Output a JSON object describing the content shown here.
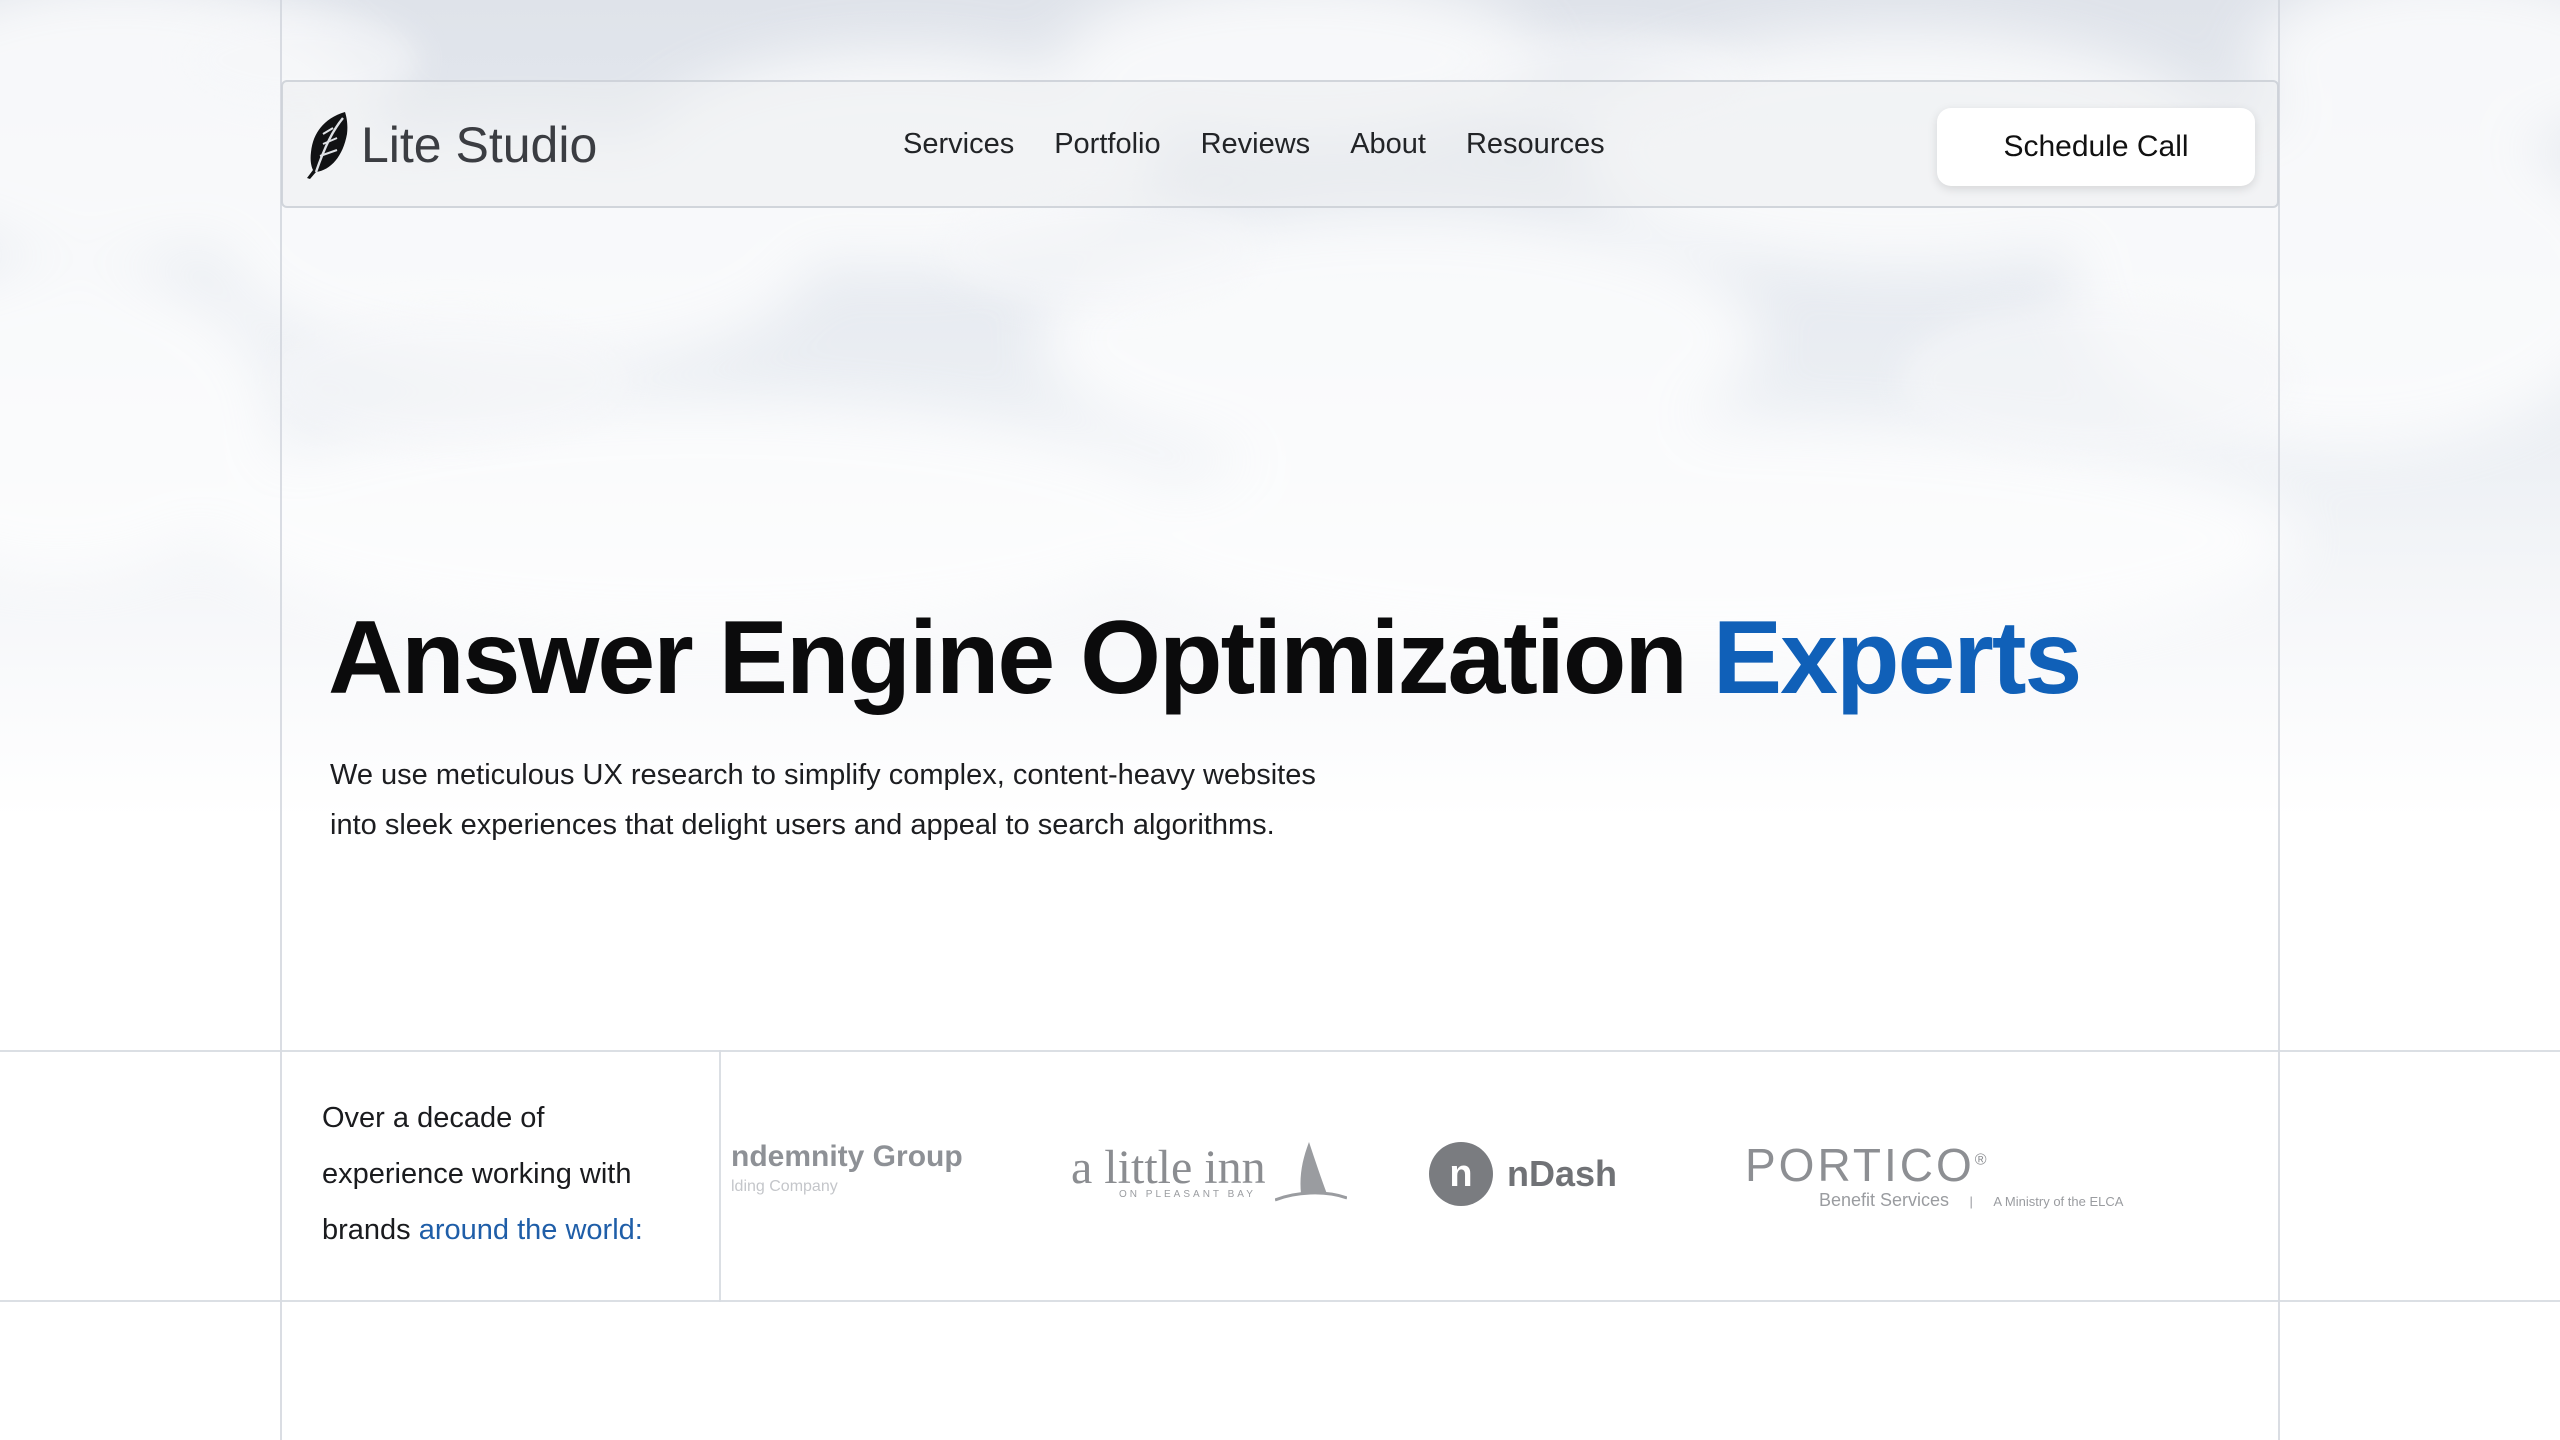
{
  "brand": {
    "name": "Lite Studio",
    "logo_icon": "feather-icon"
  },
  "nav": {
    "items": [
      {
        "label": "Services"
      },
      {
        "label": "Portfolio"
      },
      {
        "label": "Reviews"
      },
      {
        "label": "About"
      },
      {
        "label": "Resources"
      }
    ]
  },
  "cta": {
    "label": "Schedule Call"
  },
  "hero": {
    "title_main": "Answer Engine Optimization",
    "title_accent": "Experts",
    "subtitle_line1": "We use meticulous UX research to simplify complex, content-heavy websites",
    "subtitle_line2": "into sleek experiences that delight users and appeal to search algorithms."
  },
  "brands": {
    "intro_line1": "Over a decade of",
    "intro_line2": "experience working with",
    "intro_line3_prefix": "brands",
    "intro_line3_accent": "around the world:",
    "logos": [
      {
        "name": "ndemnity Group",
        "sub": "lding Company"
      },
      {
        "name": "a little inn",
        "sub": "ON PLEASANT BAY"
      },
      {
        "name": "nDash",
        "mark": "n"
      },
      {
        "name": "PORTICO",
        "reg": "®",
        "sub_a": "Benefit Services",
        "sub_sep": "|",
        "sub_b": "A Ministry of the ELCA"
      }
    ]
  },
  "colors": {
    "accent": "#1060b8",
    "accent_link": "#1f5ea8",
    "text": "#0b0b0c"
  }
}
